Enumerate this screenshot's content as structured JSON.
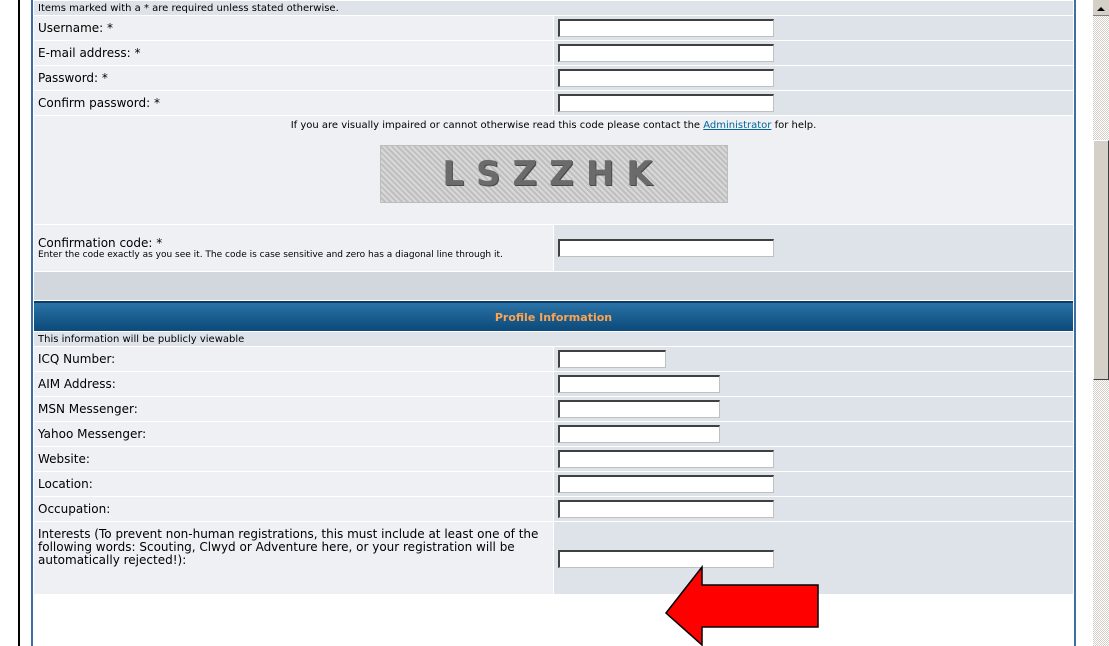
{
  "registration": {
    "required_note": "Items marked with a * are required unless stated otherwise.",
    "username_label": "Username: *",
    "email_label": "E-mail address: *",
    "password_label": "Password: *",
    "confirm_password_label": "Confirm password: *",
    "captcha": {
      "help_before": "If you are visually impaired or cannot otherwise read this code please contact the ",
      "help_link": "Administrator",
      "help_after": " for help.",
      "image_text": "LSZZHK"
    },
    "confirmation_code_label": "Confirmation code: *",
    "confirmation_code_hint": "Enter the code exactly as you see it. The code is case sensitive and zero has a diagonal line through it."
  },
  "profile": {
    "heading": "Profile Information",
    "public_note": "This information will be publicly viewable",
    "icq_label": "ICQ Number:",
    "aim_label": "AIM Address:",
    "msn_label": "MSN Messenger:",
    "yahoo_label": "Yahoo Messenger:",
    "website_label": "Website:",
    "location_label": "Location:",
    "occupation_label": "Occupation:",
    "interests_label": "Interests (To prevent non-human registrations, this must include at least one of the following words: Scouting, Clwyd or Adventure here, or your registration will be automatically rejected!):"
  },
  "colors": {
    "arrow": "#ff0000",
    "header_text": "#ffa34f",
    "header_bg": "#1a5d8f",
    "row_light": "#eff0f3",
    "row_dark": "#dee3ea",
    "link": "#006699"
  }
}
